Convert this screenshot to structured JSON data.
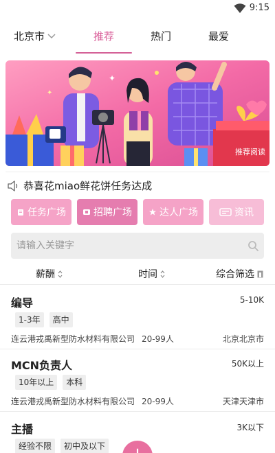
{
  "status_bar": {
    "time": "9:15"
  },
  "top_nav": {
    "city": "北京市",
    "tabs": [
      {
        "label": "推荐",
        "active": true
      },
      {
        "label": "热门",
        "active": false
      },
      {
        "label": "最爱",
        "active": false
      }
    ]
  },
  "banner": {
    "badge": "推荐阅读"
  },
  "notice": {
    "text": "恭喜花miao鲜花饼任务达成"
  },
  "quick_links": [
    {
      "label": "任务广场",
      "icon": "task-icon"
    },
    {
      "label": "招聘广场",
      "icon": "recruit-icon"
    },
    {
      "label": "达人广场",
      "icon": "star-icon"
    },
    {
      "label": "资讯",
      "icon": "news-icon"
    }
  ],
  "search": {
    "placeholder": "请输入关键字"
  },
  "filters": [
    {
      "label": "薪酬"
    },
    {
      "label": "时间"
    },
    {
      "label": "综合筛选"
    }
  ],
  "jobs": [
    {
      "title": "编导",
      "salary": "5-10K",
      "tags": [
        "1-3年",
        "高中"
      ],
      "company": "连云港戎禹新型防水材料有限公司",
      "size": "20-99人",
      "location": "北京北京市"
    },
    {
      "title": "MCN负责人",
      "salary": "50K以上",
      "tags": [
        "10年以上",
        "本科"
      ],
      "company": "连云港戎禹新型防水材料有限公司",
      "size": "20-99人",
      "location": "天津天津市"
    },
    {
      "title": "主播",
      "salary": "3K以下",
      "tags": [
        "经验不限",
        "初中及以下"
      ],
      "company": "",
      "size": "",
      "location": ""
    }
  ],
  "fab": {
    "label": "+"
  },
  "colors": {
    "accent": "#d85b97",
    "quick_button": "#f5a3c7",
    "quick_button_active": "#e57daf"
  }
}
